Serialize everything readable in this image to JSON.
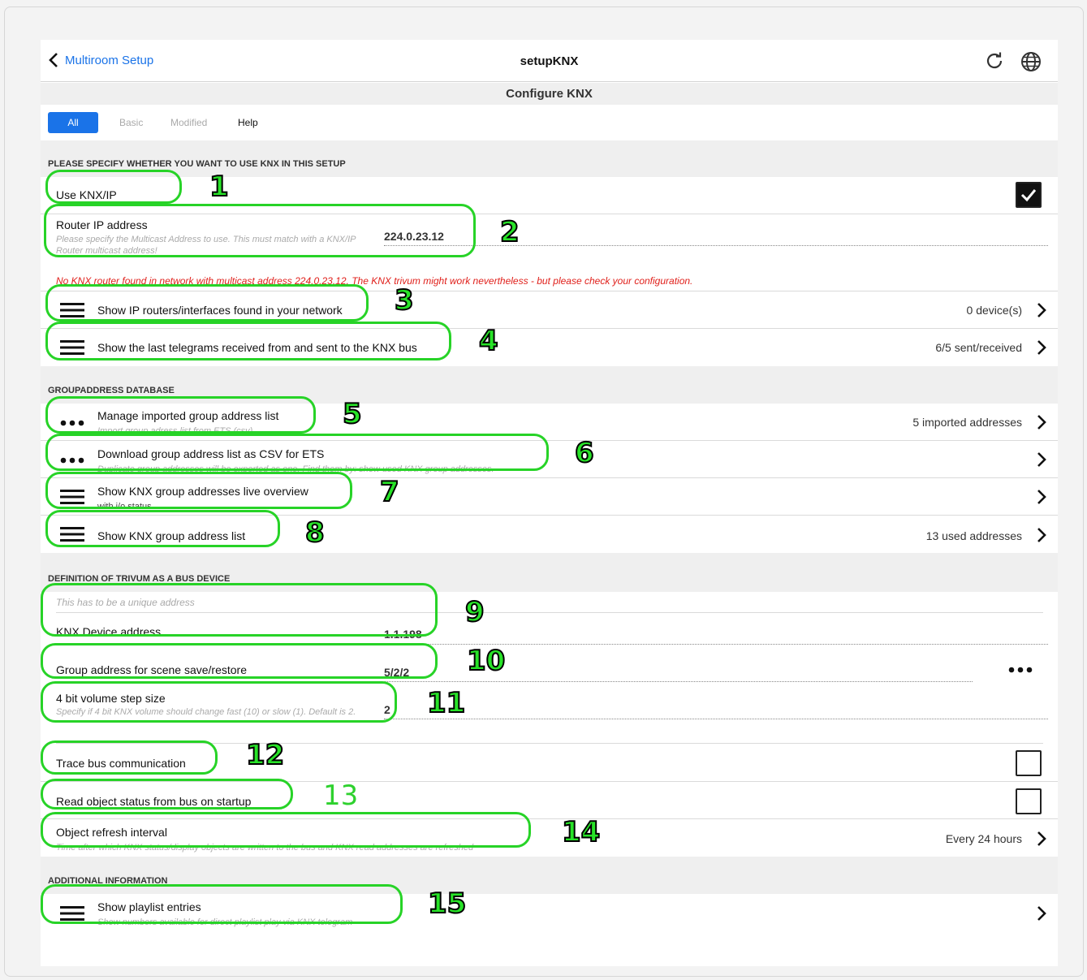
{
  "nav": {
    "back_label": "Multiroom Setup",
    "title": "setupKNX",
    "refresh_icon": "refresh-icon",
    "globe_icon": "globe-icon"
  },
  "subtitle": "Configure KNX",
  "tabs": [
    {
      "label": "All",
      "active": true
    },
    {
      "label": "Basic",
      "active": false
    },
    {
      "label": "Modified",
      "active": false
    },
    {
      "label": "Help",
      "active": false
    }
  ],
  "sections": {
    "s1": "PLEASE SPECIFY WHETHER YOU WANT TO USE KNX IN THIS SETUP",
    "s2": "GROUPADDRESS DATABASE",
    "s3": "DEFINITION OF TRIVUM AS A BUS DEVICE",
    "s4": "ADDITIONAL INFORMATION"
  },
  "use_knx": {
    "label": "Use KNX/IP",
    "checked": true
  },
  "router_ip": {
    "label": "Router IP address",
    "hint": "Please specify the Multicast Address to use. This must match with a KNX/IP Router multicast address!",
    "value": "224.0.23.12"
  },
  "error_msg": "No KNX router found in network with multicast address 224.0.23.12. The KNX trivum might work nevertheless - but please check your configuration.",
  "ip_routers": {
    "label": "Show IP routers/interfaces found in your network",
    "value": "0 device(s)"
  },
  "telegrams": {
    "label": "Show the last telegrams received from and sent to the KNX bus",
    "value": "6/5 sent/received"
  },
  "manage_list": {
    "label": "Manage imported group address list",
    "hint": "Import group adress list from ETS (csv)",
    "value": "5 imported addresses"
  },
  "download_list": {
    "label": "Download group address list as CSV for ETS",
    "hint": "Duplicate group addresses will be exported as one. Find them by: show used KNX group addresses."
  },
  "live_overview": {
    "label": "Show KNX group addresses live overview",
    "hint": "with i/o status"
  },
  "ga_list": {
    "label": "Show KNX group address list",
    "value": "13 used addresses"
  },
  "device_address": {
    "hint": "This has to be a unique address",
    "label": "KNX Device address",
    "value": "1.1.198"
  },
  "scene_address": {
    "label": "Group address for scene save/restore",
    "value": "5/2/2"
  },
  "volume_step": {
    "label": "4 bit volume step size",
    "hint": "Specify if 4 bit KNX volume should change fast (10) or slow (1). Default is 2.",
    "value": "2"
  },
  "trace_bus": {
    "label": "Trace bus communication",
    "checked": false
  },
  "read_status": {
    "label": "Read object status from bus on startup",
    "checked": false
  },
  "refresh_interval": {
    "label": "Object refresh interval",
    "hint": "Time after which KNX status/display objects are written to the bus and KNX read addresses are refreshed",
    "value": "Every 24 hours"
  },
  "playlist": {
    "label": "Show playlist entries",
    "hint": "Show numbers available for direct playlist play via KNX telegram"
  },
  "callouts": [
    "1",
    "2",
    "3",
    "4",
    "5",
    "6",
    "7",
    "8",
    "9",
    "10",
    "11",
    "12",
    "13",
    "14",
    "15"
  ],
  "colors": {
    "accent": "#1a73e8",
    "error": "#e0201b",
    "annotation": "#28e328"
  }
}
